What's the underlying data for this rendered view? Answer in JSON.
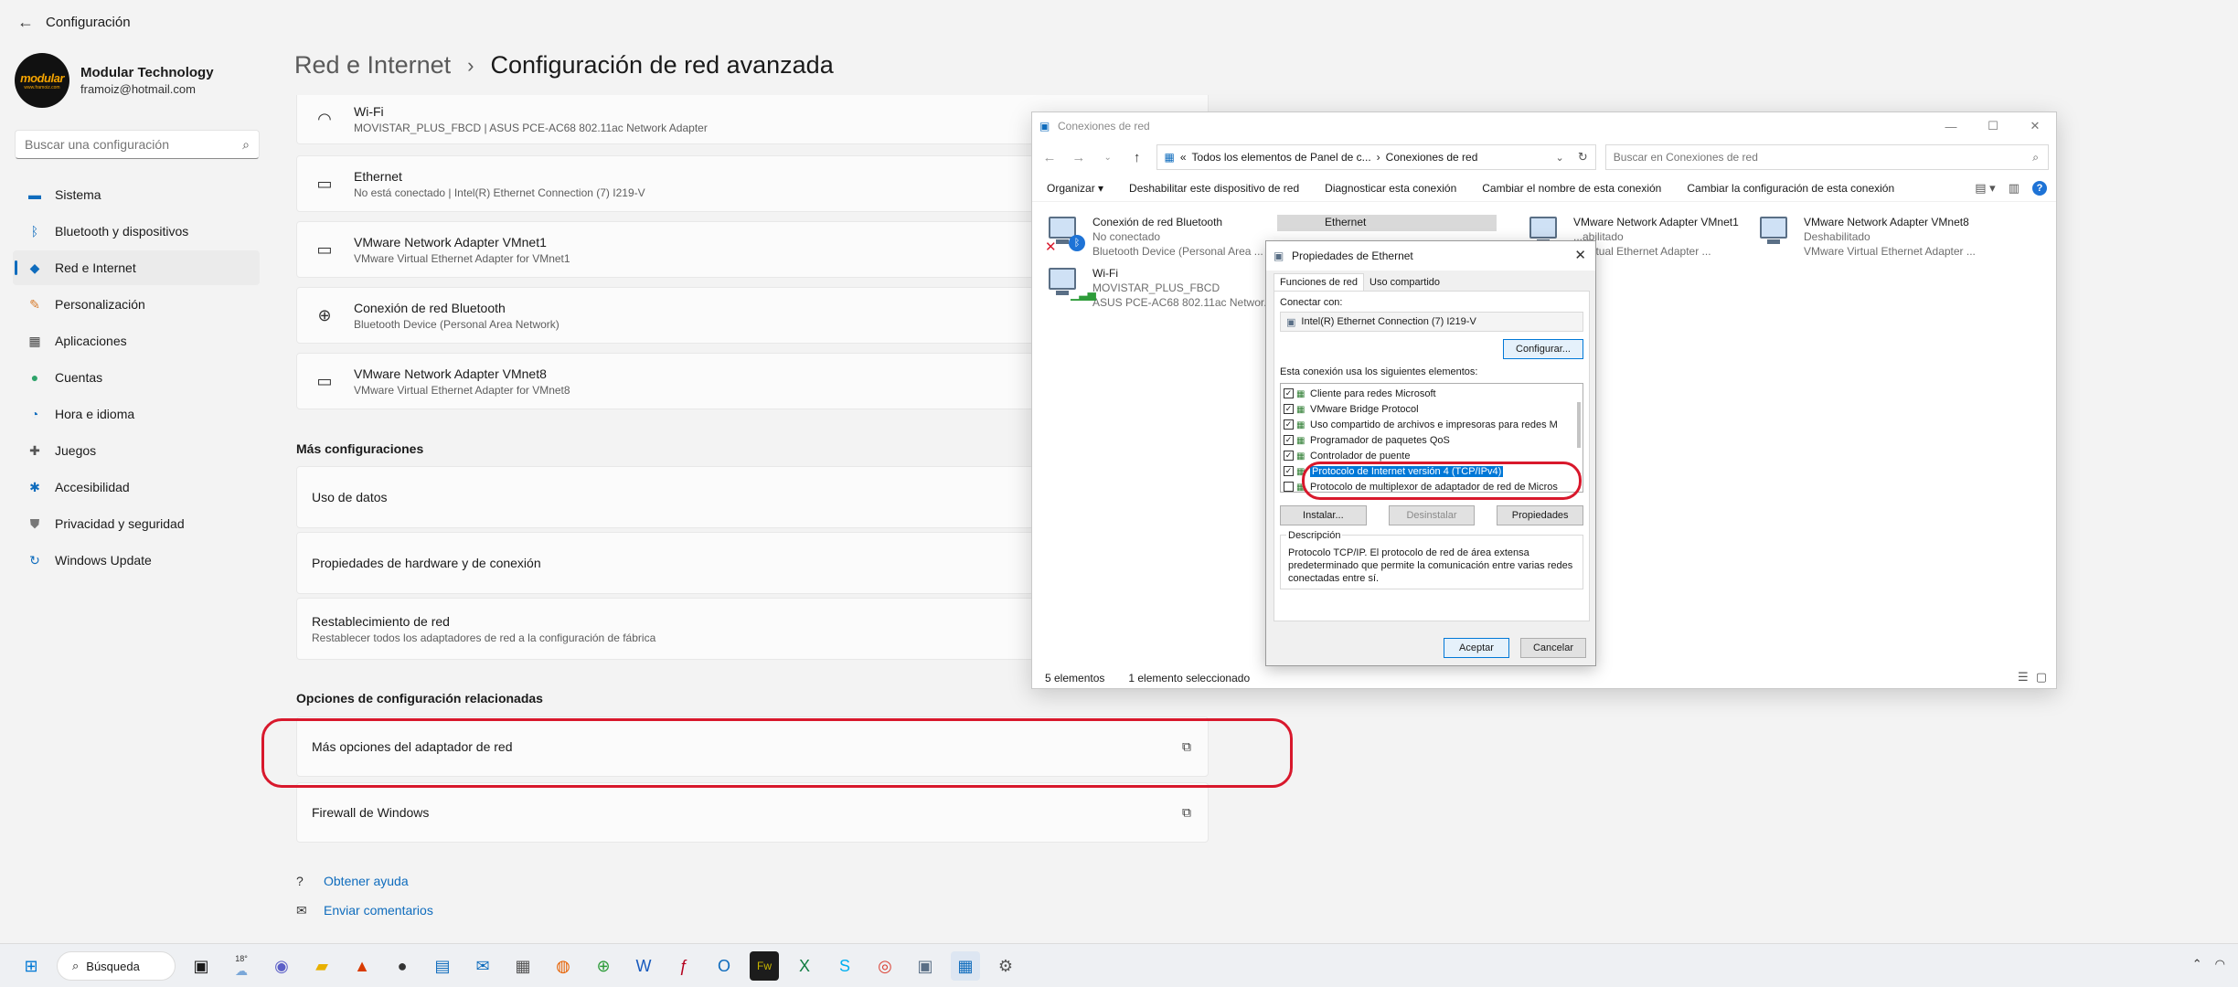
{
  "settings": {
    "app_title": "Configuración",
    "profile": {
      "brand_logo": "modular",
      "brand_sub": "www.framoiz.com",
      "name": "Modular Technology",
      "email": "framoiz@hotmail.com"
    },
    "search": {
      "placeholder": "Buscar una configuración"
    },
    "nav": [
      {
        "label": "Sistema",
        "icon": "monitor-icon"
      },
      {
        "label": "Bluetooth y dispositivos",
        "icon": "bluetooth-icon"
      },
      {
        "label": "Red e Internet",
        "icon": "network-icon",
        "active": true
      },
      {
        "label": "Personalización",
        "icon": "brush-icon"
      },
      {
        "label": "Aplicaciones",
        "icon": "apps-icon"
      },
      {
        "label": "Cuentas",
        "icon": "person-icon"
      },
      {
        "label": "Hora e idioma",
        "icon": "globe-clock-icon"
      },
      {
        "label": "Juegos",
        "icon": "gamepad-icon"
      },
      {
        "label": "Accesibilidad",
        "icon": "accessibility-icon"
      },
      {
        "label": "Privacidad y seguridad",
        "icon": "shield-icon"
      },
      {
        "label": "Windows Update",
        "icon": "update-icon"
      }
    ],
    "breadcrumb": {
      "parent": "Red e Internet",
      "separator": "›",
      "current": "Configuración de red avanzada"
    },
    "adapters": [
      {
        "title": "Wi-Fi",
        "sub": "MOVISTAR_PLUS_FBCD | ASUS PCE-AC68 802.11ac Network Adapter",
        "icon": "wifi-icon"
      },
      {
        "title": "Ethernet",
        "sub": "No está conectado | Intel(R) Ethernet Connection (7) I219-V",
        "icon": "ethernet-icon"
      },
      {
        "title": "VMware Network Adapter VMnet1",
        "sub": "VMware Virtual Ethernet Adapter for VMnet1",
        "icon": "ethernet-icon"
      },
      {
        "title": "Conexión de red Bluetooth",
        "sub": "Bluetooth Device (Personal Area Network)",
        "icon": "globe-icon"
      },
      {
        "title": "VMware Network Adapter VMnet8",
        "sub": "VMware Virtual Ethernet Adapter for VMnet8",
        "icon": "ethernet-icon"
      }
    ],
    "more_section": "Más configuraciones",
    "more": [
      {
        "title": "Uso de datos",
        "sub": ""
      },
      {
        "title": "Propiedades de hardware y de conexión",
        "sub": ""
      },
      {
        "title": "Restablecimiento de red",
        "sub": "Restablecer todos los adaptadores de red a la configuración de fábrica"
      }
    ],
    "related_section": "Opciones de configuración relacionadas",
    "related": [
      {
        "title": "Más opciones del adaptador de red"
      },
      {
        "title": "Firewall de Windows"
      }
    ],
    "help": [
      {
        "label": "Obtener ayuda",
        "icon": "help-icon"
      },
      {
        "label": "Enviar comentarios",
        "icon": "feedback-icon"
      }
    ]
  },
  "netwin": {
    "title": "Conexiones de red",
    "address": {
      "prefix": "«",
      "path1": "Todos los elementos de Panel de c...",
      "sep": "›",
      "path2": "Conexiones de red"
    },
    "search_placeholder": "Buscar en Conexiones de red",
    "toolbar": [
      "Organizar ▾",
      "Deshabilitar este dispositivo de red",
      "Diagnosticar esta conexión",
      "Cambiar el nombre de esta conexión",
      "Cambiar la configuración de esta conexión"
    ],
    "adapters": [
      {
        "name": "Conexión de red Bluetooth",
        "l2": "No conectado",
        "l3": "Bluetooth Device (Personal Area ..."
      },
      {
        "name": "Ethernet",
        "l2": "",
        "l3": ""
      },
      {
        "name": "VMware Network Adapter VMnet1",
        "l2": "...abilitado",
        "l3": "...Virtual Ethernet Adapter ..."
      },
      {
        "name": "VMware Network Adapter VMnet8",
        "l2": "Deshabilitado",
        "l3": "VMware Virtual Ethernet Adapter ..."
      },
      {
        "name": "Wi-Fi",
        "l2": "MOVISTAR_PLUS_FBCD",
        "l3": "ASUS PCE-AC68 802.11ac Networ..."
      }
    ],
    "status_count": "5 elementos",
    "status_selected": "1 elemento seleccionado"
  },
  "dialog": {
    "title": "Propiedades de Ethernet",
    "tabs": [
      "Funciones de red",
      "Uso compartido"
    ],
    "connect_with": "Conectar con:",
    "adapter_name": "Intel(R) Ethernet Connection (7) I219-V",
    "configure": "Configurar...",
    "uses_label": "Esta conexión usa los siguientes elementos:",
    "items": [
      {
        "label": "Cliente para redes Microsoft",
        "checked": true
      },
      {
        "label": "VMware Bridge Protocol",
        "checked": true
      },
      {
        "label": "Uso compartido de archivos e impresoras para redes M",
        "checked": true
      },
      {
        "label": "Programador de paquetes QoS",
        "checked": true
      },
      {
        "label": "Controlador de puente",
        "checked": true
      },
      {
        "label": "Protocolo de Internet versión 4 (TCP/IPv4)",
        "checked": true,
        "highlighted": true
      },
      {
        "label": "Protocolo de multiplexor de adaptador de red de Micros",
        "checked": false
      }
    ],
    "install": "Instalar...",
    "uninstall": "Desinstalar",
    "properties": "Propiedades",
    "desc_label": "Descripción",
    "desc_text": "Protocolo TCP/IP. El protocolo de red de área extensa predeterminado que permite la comunicación entre varias redes conectadas entre sí.",
    "ok": "Aceptar",
    "cancel": "Cancelar"
  },
  "taskbar": {
    "search_label": "Búsqueda",
    "temperature": "18°",
    "icons": [
      "start-icon",
      "search",
      "task-view-icon",
      "weather-icon",
      "teams-icon",
      "explorer-icon",
      "pdf-icon",
      "app-icon",
      "store-icon",
      "mail-icon",
      "calculator-icon",
      "firefox-icon",
      "network-globe-icon",
      "word-icon",
      "f6-icon",
      "outlook-icon",
      "fireworks-icon",
      "excel-icon",
      "skype-icon",
      "chrome-icon",
      "network-pc-icon",
      "control-panel-icon",
      "settings-icon"
    ]
  },
  "colors": {
    "accent": "#0f6cbd",
    "highlight_oval": "#d8182c",
    "selection": "#0078d7"
  }
}
